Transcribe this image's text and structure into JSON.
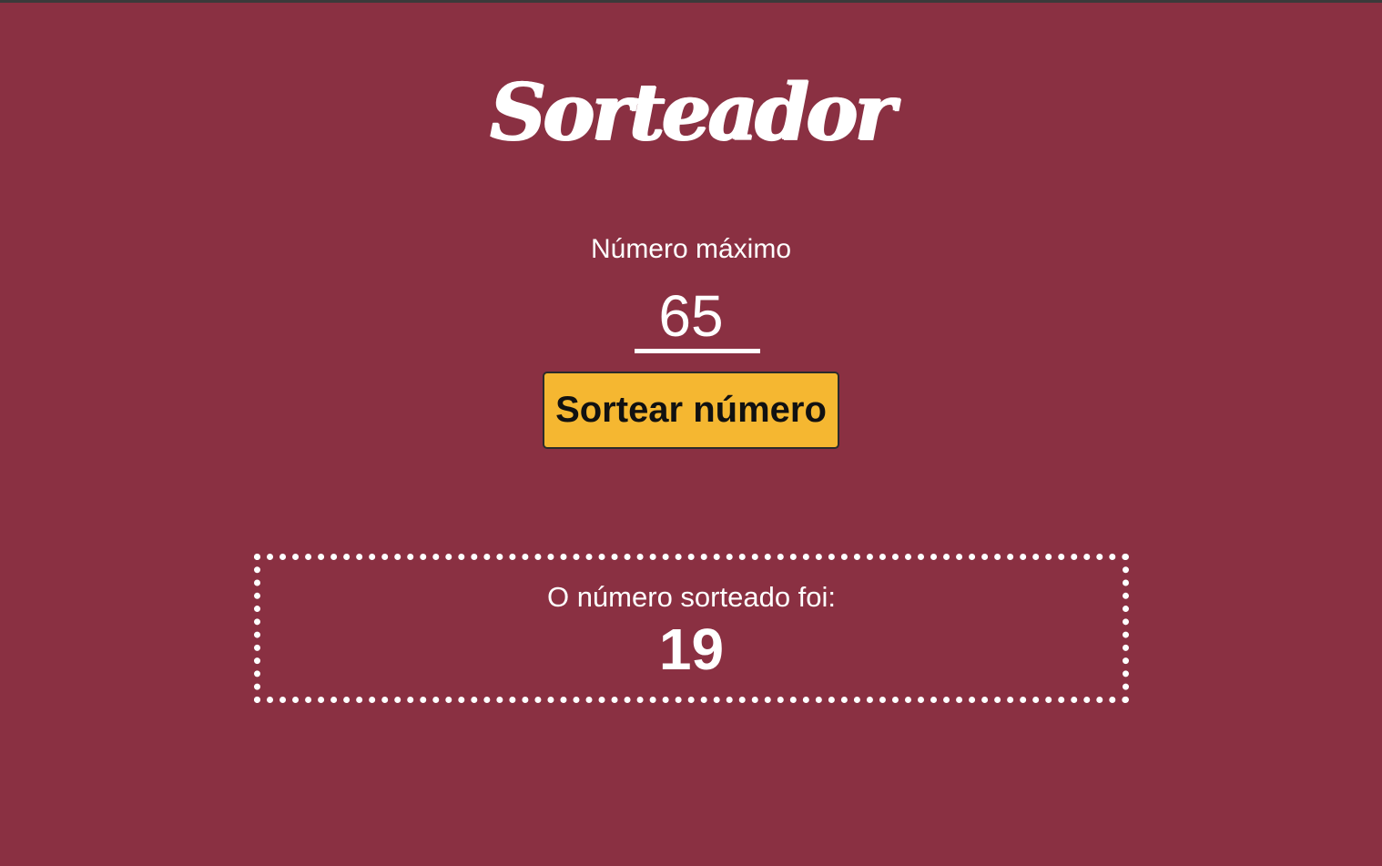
{
  "header": {
    "title": "Sorteador"
  },
  "form": {
    "max_label": "Número máximo",
    "max_value": "65",
    "draw_button_label": "Sortear número"
  },
  "result": {
    "label": "O número sorteado foi:",
    "value": "19"
  },
  "colors": {
    "background": "#8a3042",
    "accent": "#f5b731",
    "text": "#ffffff"
  }
}
